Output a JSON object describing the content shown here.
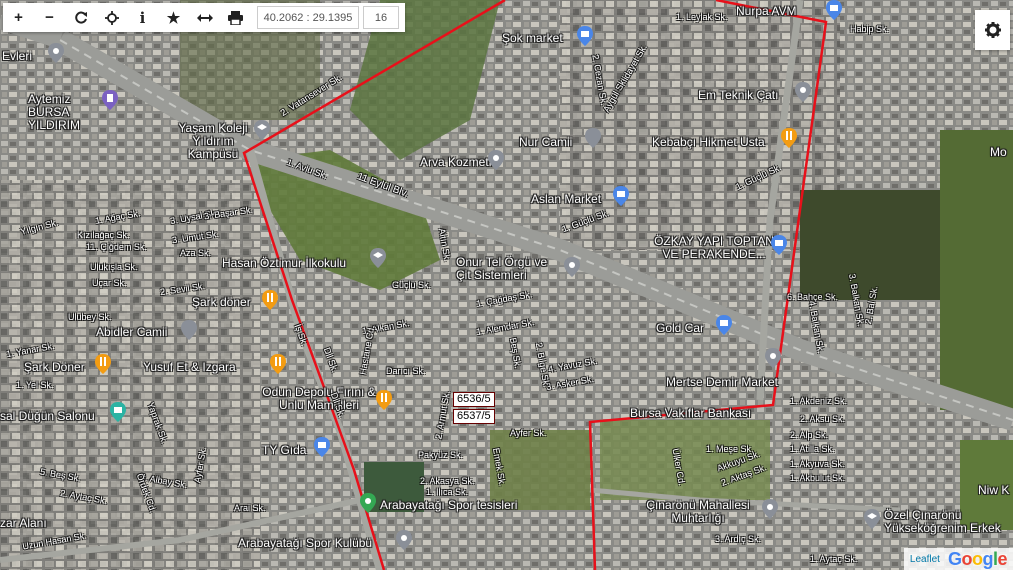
{
  "toolbar": {
    "buttons": [
      {
        "name": "zoom-in-button",
        "icon": "plus-icon",
        "glyph": "+"
      },
      {
        "name": "zoom-out-button",
        "icon": "minus-icon",
        "glyph": "−"
      },
      {
        "name": "refresh-button",
        "icon": "refresh-icon",
        "glyph": ""
      },
      {
        "name": "locate-button",
        "icon": "crosshair-icon",
        "glyph": ""
      },
      {
        "name": "info-button",
        "icon": "info-icon",
        "glyph": "i"
      },
      {
        "name": "favorite-button",
        "icon": "star-icon",
        "glyph": "★"
      },
      {
        "name": "measure-button",
        "icon": "measure-icon",
        "glyph": ""
      },
      {
        "name": "print-button",
        "icon": "printer-icon",
        "glyph": ""
      }
    ],
    "coordinates": "40.2062 : 29.1395",
    "zoom": "16"
  },
  "settings_icon": "gear-icon",
  "places": [
    "Nurpa AVM",
    "1. Leylak Sk.",
    "Habip Sk.",
    "Şok market",
    "Evleri",
    "Aytemiz BURSA YILDIRIM",
    "Yaşam Koleji Yıldırım Kampüsü",
    "Em Teknik Çatı",
    "Nur Camii",
    "Kebabçı Hikmet Usta",
    "Arva Kozmetik",
    "Aslan Market",
    "ÖZKAY YAPI TOPTAN VE PERAKENDE...",
    "Hasan Öztimur İlkokulu",
    "Onur Tel Örgü ve Çit Sistemleri",
    "Şark döner",
    "Abidler Camii",
    "Gold Car",
    "Şark Döner",
    "Yusuf Et & Izgara",
    "Mertse Demir Market",
    "Odun Depolu Fırını & Unlu Mamülleri",
    "Bursa Vakıflar Bankası",
    "sal Düğün Salonu",
    "TY Gıda",
    "Arabayatağı Spor tesisleri",
    "Çınarönü Mahallesi Muhtarlığı",
    "Özel Çınarönü Yükseköğrenim Erkek",
    "zar Alanı",
    "Arabayatağı Spor Kulübü",
    "Mo",
    "Niw K"
  ],
  "streets": [
    "2. Vatansever Sk.",
    "1. Avlu Sk.",
    "11 Eylül Blv.",
    "2. Cezan Sk.",
    "Hidayet Sk.",
    "Aygül Sk.",
    "1. Güçlü Sk.",
    "1. Güçlü Sk.",
    "1. Ağaç Sk.",
    "3. Uysal Sk.",
    "Kızılağaç Sk.",
    "11. Çiğdem Sk.",
    "3. Umut Sk.",
    "3. Başar Sk.",
    "Yılgın Sk.",
    "Ulukışla Sk.",
    "Aza Sk.",
    "Uçar Sk.",
    "2. Sevil Sk.",
    "Ulubey Sk.",
    "Güçlü Sk.",
    "Altın Sk.",
    "1. Çağdaş Sk.",
    "1. Alemdar Sk.",
    "1. Alkan Sk.",
    "Hastane Cd.",
    "Darıcı Sk.",
    "4. Yavuz Sk.",
    "3. Asker Sk.",
    "Beş Sk.",
    "2. Bilge Sk.",
    "1. Yanar Sk.",
    "1. Yel Sk.",
    "6. Bahçe Sk.",
    "3. Balkan Sk.",
    "4. Balkan Sk.",
    "2. Bal Sk.",
    "1. Akdeniz Sk.",
    "2. Aksu Sk.",
    "2. Alp Sk.",
    "1. Atilla Sk.",
    "1. Akyuva Sk.",
    "1. Akbulut Sk.",
    "1. Meşe Sk.",
    "Akkuyu Sk.",
    "2. Aktaş Sk.",
    "Ayfer Sk.",
    "Pakyüz Sk.",
    "2. Akasya Sk.",
    "1. Ilıca Sk.",
    "Emek Sk.",
    "2. Armut Sk.",
    "Ülker Cd.",
    "3. Ardıç Sk.",
    "1. Aytaç Sk.",
    "5. Beş Sk.",
    "2. Aytaç Sk.",
    "3. Albay Sk.",
    "Ayfer Sk.",
    "Arai Sk.",
    "Uzun Hasan Sk.",
    "İş Sk.",
    "Dil Sk.",
    "Dil Sk.",
    "Yaprak Sk.",
    "Ördek Cd."
  ],
  "parcels": [
    "6536/5",
    "6537/5"
  ],
  "boundary_color": "#e8101a",
  "attribution": {
    "leaflet": "Leaflet",
    "google": "Google"
  }
}
